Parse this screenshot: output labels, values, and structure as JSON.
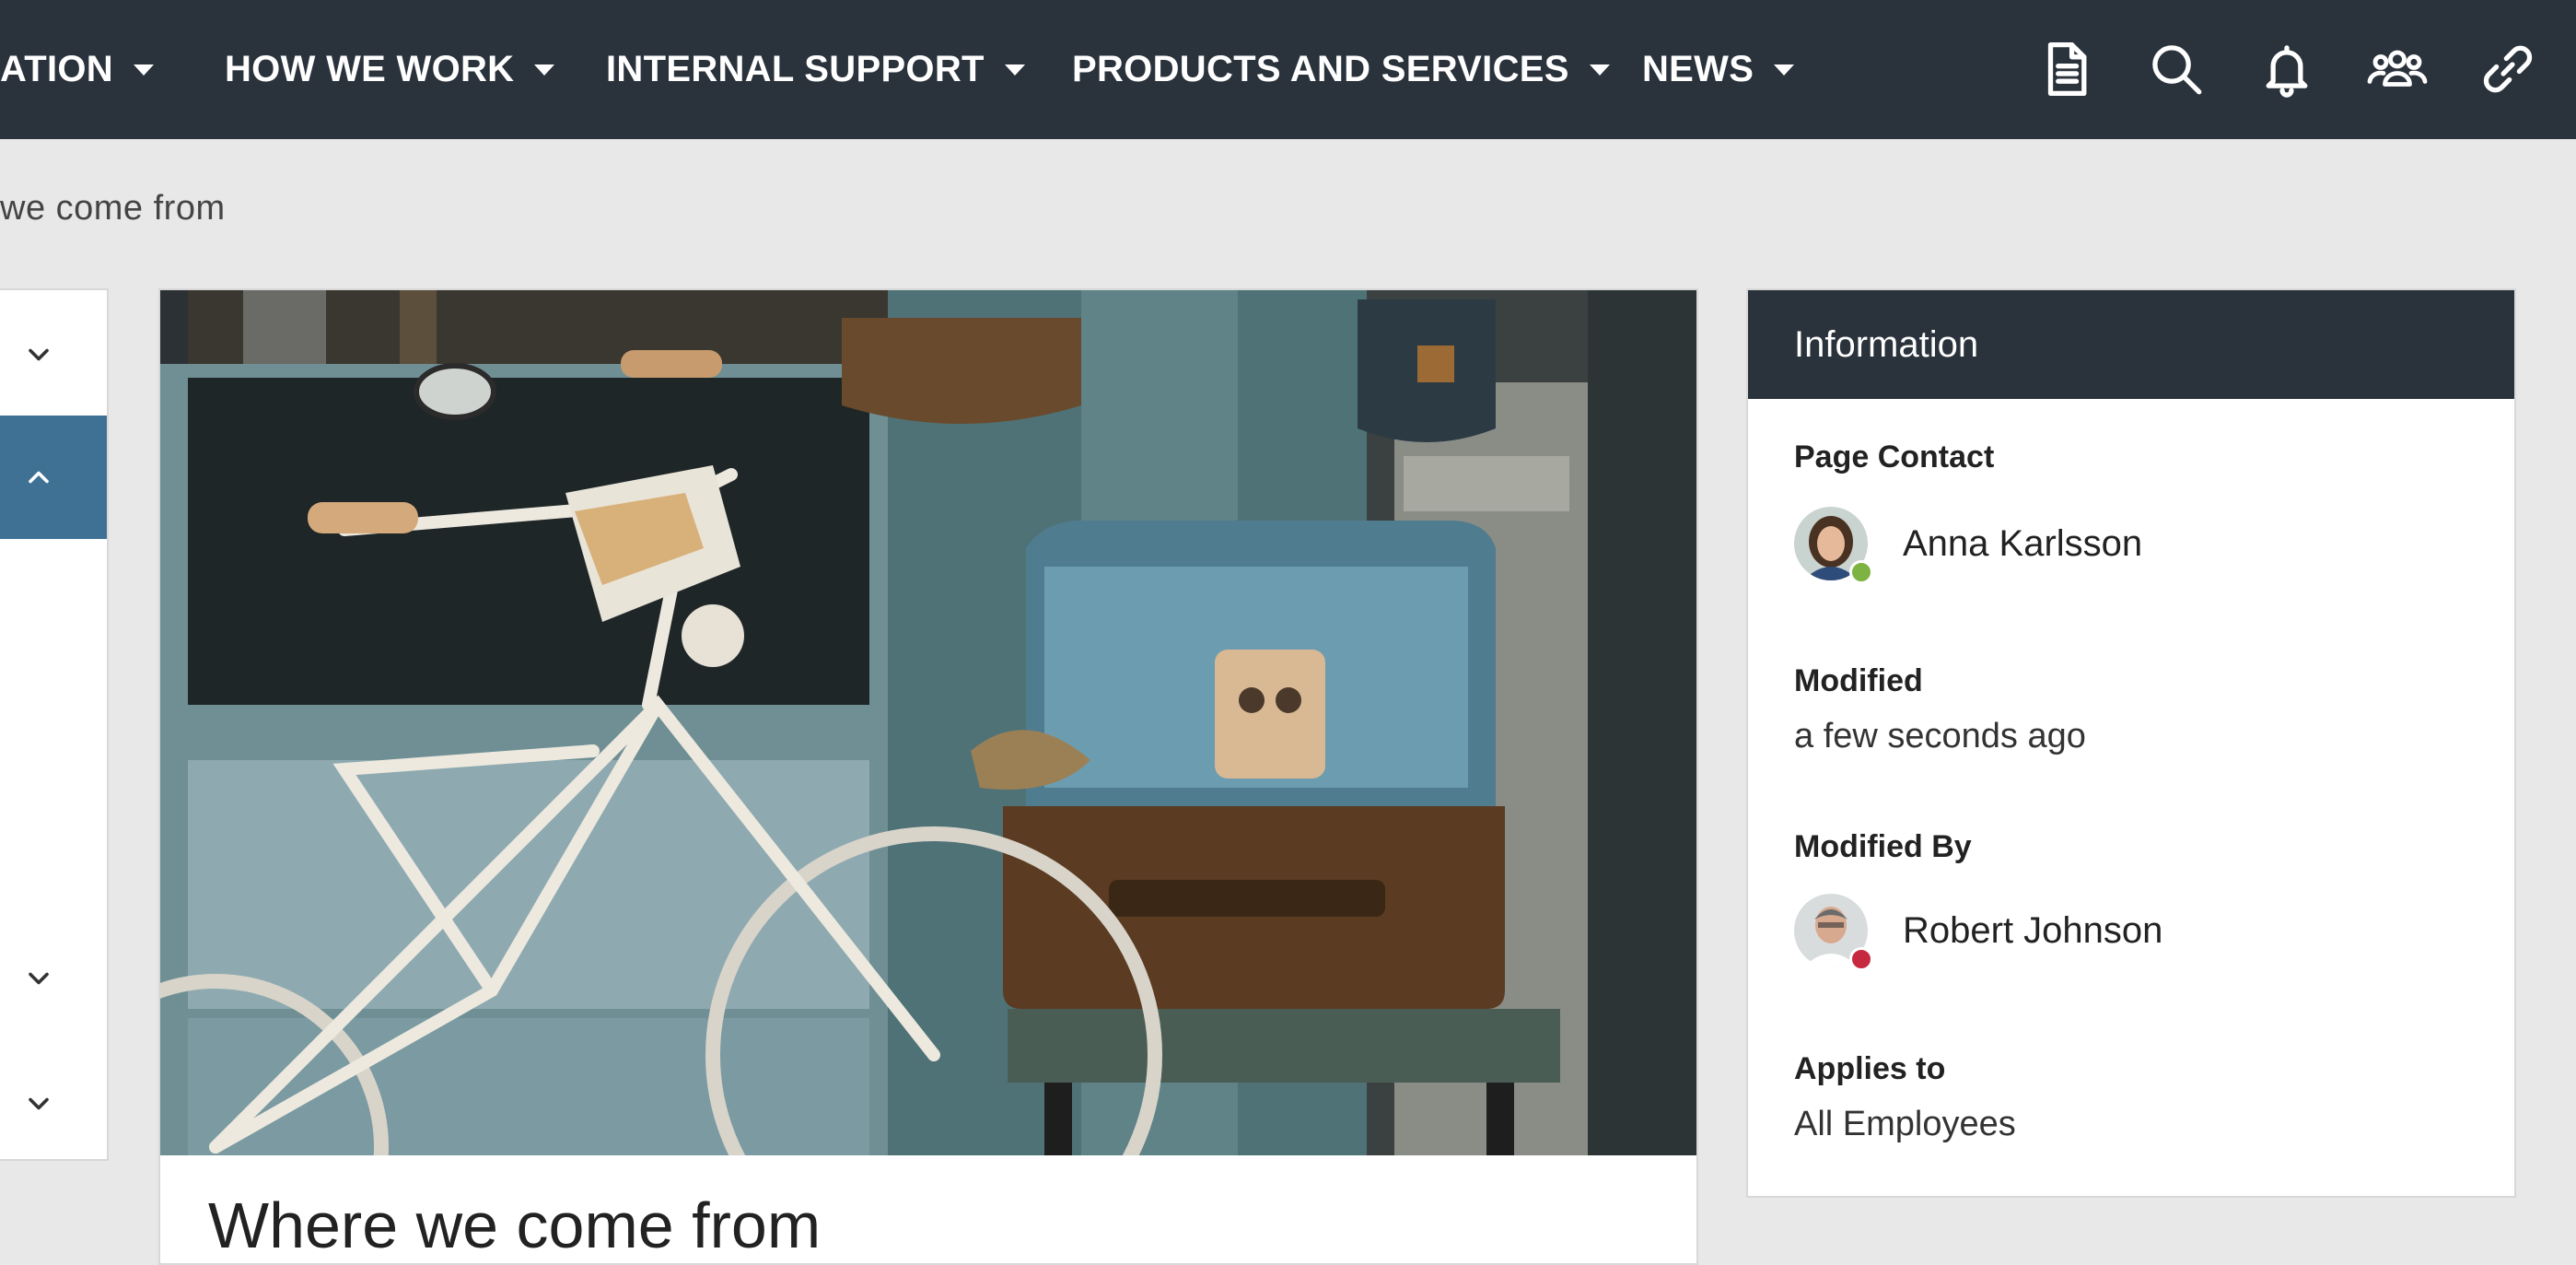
{
  "nav": {
    "items": [
      {
        "label": "ATION"
      },
      {
        "label": "HOW WE WORK"
      },
      {
        "label": "INTERNAL SUPPORT"
      },
      {
        "label": "PRODUCTS AND SERVICES"
      },
      {
        "label": "NEWS"
      }
    ],
    "icons": [
      "document-icon",
      "search-icon",
      "bell-icon",
      "people-icon",
      "link-icon"
    ]
  },
  "breadcrumb": "we come from",
  "main": {
    "heading": "Where we come from"
  },
  "info": {
    "title": "Information",
    "page_contact_label": "Page Contact",
    "page_contact_name": "Anna Karlsson",
    "page_contact_status_color": "#7cb342",
    "modified_label": "Modified",
    "modified_value": "a few seconds ago",
    "modified_by_label": "Modified By",
    "modified_by_name": "Robert Johnson",
    "modified_by_status_color": "#c62840",
    "applies_to_label": "Applies to",
    "applies_to_value": "All Employees"
  },
  "colors": {
    "topbar": "#2a323b",
    "accent": "#3f7195",
    "background": "#e8e8e8"
  }
}
